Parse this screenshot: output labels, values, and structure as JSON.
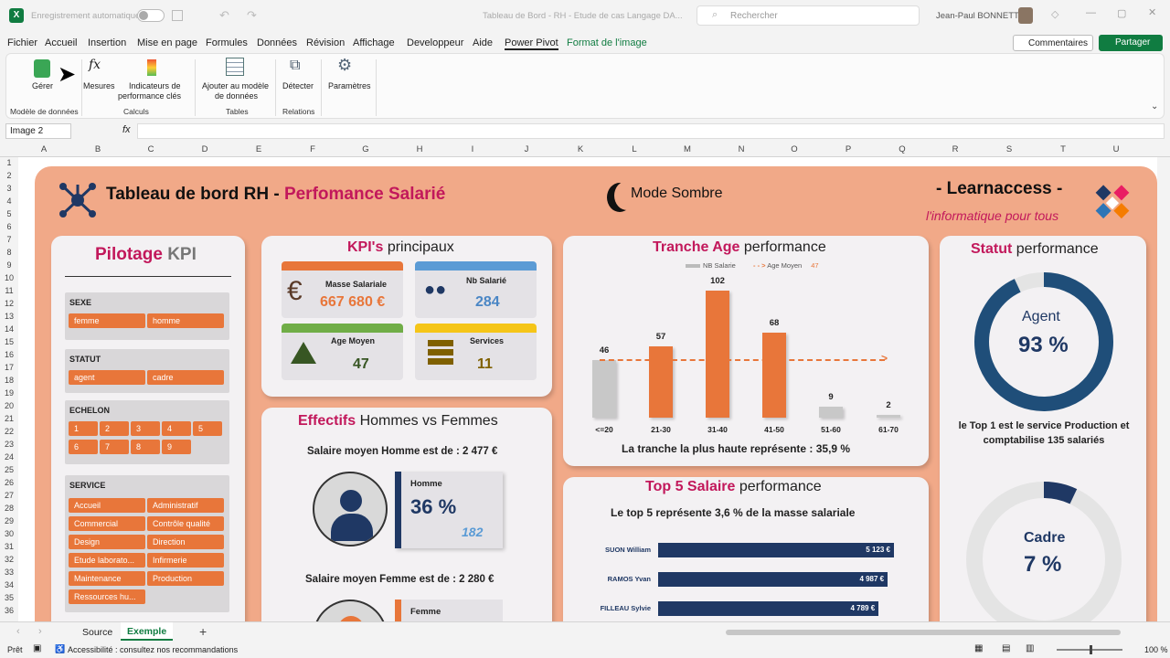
{
  "titlebar": {
    "autosave": "Enregistrement automatique",
    "doc_title": "Tableau de Bord - RH - Etude de cas Langage DA...",
    "search_placeholder": "Rechercher",
    "user": "Jean-Paul BONNETTO"
  },
  "menu": [
    "Fichier",
    "Accueil",
    "Insertion",
    "Mise en page",
    "Formules",
    "Données",
    "Révision",
    "Affichage",
    "Developpeur",
    "Aide",
    "Power Pivot",
    "Format de l'image"
  ],
  "comments_label": "Commentaires",
  "share_label": "Partager",
  "ribbon": {
    "manage": "Gérer",
    "measures": "Mesures",
    "kpi1": "Indicateurs de",
    "kpi2": "performance clés",
    "add1": "Ajouter au modèle",
    "add2": "de données",
    "detect": "Détecter",
    "settings": "Paramètres",
    "g_model": "Modèle de données",
    "g_calc": "Calculs",
    "g_tables": "Tables",
    "g_rel": "Relations"
  },
  "namebox": "Image 2",
  "fx": "fx",
  "columns": [
    "A",
    "B",
    "C",
    "D",
    "E",
    "F",
    "G",
    "H",
    "I",
    "J",
    "K",
    "L",
    "M",
    "N",
    "O",
    "P",
    "Q",
    "R",
    "S",
    "T",
    "U"
  ],
  "rows": [
    "1",
    "2",
    "3",
    "4",
    "5",
    "6",
    "7",
    "8",
    "9",
    "10",
    "11",
    "12",
    "13",
    "14",
    "15",
    "16",
    "17",
    "18",
    "19",
    "20",
    "21",
    "22",
    "23",
    "24",
    "25",
    "26",
    "27",
    "28",
    "29",
    "30",
    "31",
    "32",
    "33",
    "34",
    "35",
    "36"
  ],
  "dashboard": {
    "title_a": "Tableau de bord RH - ",
    "title_b": "Perfomance Salarié",
    "dark_mode": "Mode Sombre",
    "brand": "- Learnaccess -",
    "tagline": "l'informatique pour tous",
    "pilot_a": "Pilotage ",
    "pilot_b": "KPI",
    "sexe_title": "SEXE",
    "sexe": [
      "femme",
      "homme"
    ],
    "statut_title": "STATUT",
    "statut": [
      "agent",
      "cadre"
    ],
    "echelon_title": "ECHELON",
    "echelon": [
      "1",
      "2",
      "3",
      "4",
      "5",
      "6",
      "7",
      "8",
      "9"
    ],
    "service_title": "SERVICE",
    "service": [
      "Accueil",
      "Administratif",
      "Commercial",
      "Contrôle qualité",
      "Design",
      "Direction",
      "Etude laborato...",
      "Infirmerie",
      "Maintenance",
      "Production",
      "Ressources hu..."
    ],
    "kpi_title_a": "KPI's ",
    "kpi_title_b": "principaux",
    "kpis": [
      {
        "label": "Masse Salariale",
        "value": "667 680 €",
        "color": "#e8763a",
        "icon": "euro-icon",
        "vcolor": "#e8763a"
      },
      {
        "label": "Nb Salarié",
        "value": "284",
        "color": "#5b9bd5",
        "icon": "people-icon",
        "vcolor": "#4a86c5"
      },
      {
        "label": "Age Moyen",
        "value": "47",
        "color": "#70ad47",
        "icon": "tree-icon",
        "vcolor": "#375623"
      },
      {
        "label": "Services",
        "value": "11",
        "color": "#f5c518",
        "icon": "server-icon",
        "vcolor": "#7f6000"
      }
    ],
    "eff_title_a": "Effectifs ",
    "eff_title_b": "Hommes vs Femmes",
    "sal_homme": "Salaire moyen Homme est de : 2 477 €",
    "homme_label": "Homme",
    "homme_pct": "36 %",
    "homme_n": "182",
    "sal_femme": "Salaire moyen Femme est de : 2 280 €",
    "femme_label": "Femme",
    "age_title_a": "Tranche Age ",
    "age_title_b": "performance",
    "age_note": "La tranche la plus haute représente : 35,9 %",
    "top5_title_a": "Top 5 Salaire ",
    "top5_title_b": "performance",
    "top5_note": "Le top 5 représente 3,6 % de la masse salariale",
    "top5": [
      {
        "name": "SUON William",
        "value": "5 123 €",
        "v": 5123
      },
      {
        "name": "RAMOS Yvan",
        "value": "4 987 €",
        "v": 4987
      },
      {
        "name": "FILLEAU Sylvie",
        "value": "4 789 €",
        "v": 4789
      }
    ],
    "statut_title_a": "Statut ",
    "statut_title_b": "performance",
    "agent_label": "Agent",
    "agent_pct": "93 %",
    "agent_frac": 0.93,
    "statut_note": "le Top 1 est le service Production et comptabilise 135 salariés",
    "cadre_label": "Cadre",
    "cadre_pct": "7 %",
    "cadre_frac": 0.07
  },
  "chart_data": {
    "type": "bar",
    "categories": [
      "<=20",
      "21-30",
      "31-40",
      "41-50",
      "51-60",
      "61-70"
    ],
    "series": [
      {
        "name": "NB Salarie",
        "values": [
          46,
          57,
          102,
          68,
          9,
          2
        ]
      },
      {
        "name": "Age Moyen",
        "values": [
          47,
          47,
          47,
          47,
          47,
          47
        ]
      }
    ],
    "legend_value": "47",
    "colors": {
      "first": "#c8c8c8",
      "bars": "#e8763a",
      "last": "#c8c8c8",
      "line": "#e8763a"
    }
  },
  "tabs": [
    "Source",
    "Exemple"
  ],
  "status": {
    "ready": "Prêt",
    "access": "Accessibilité : consultez nos recommandations",
    "zoom": "100 %"
  }
}
